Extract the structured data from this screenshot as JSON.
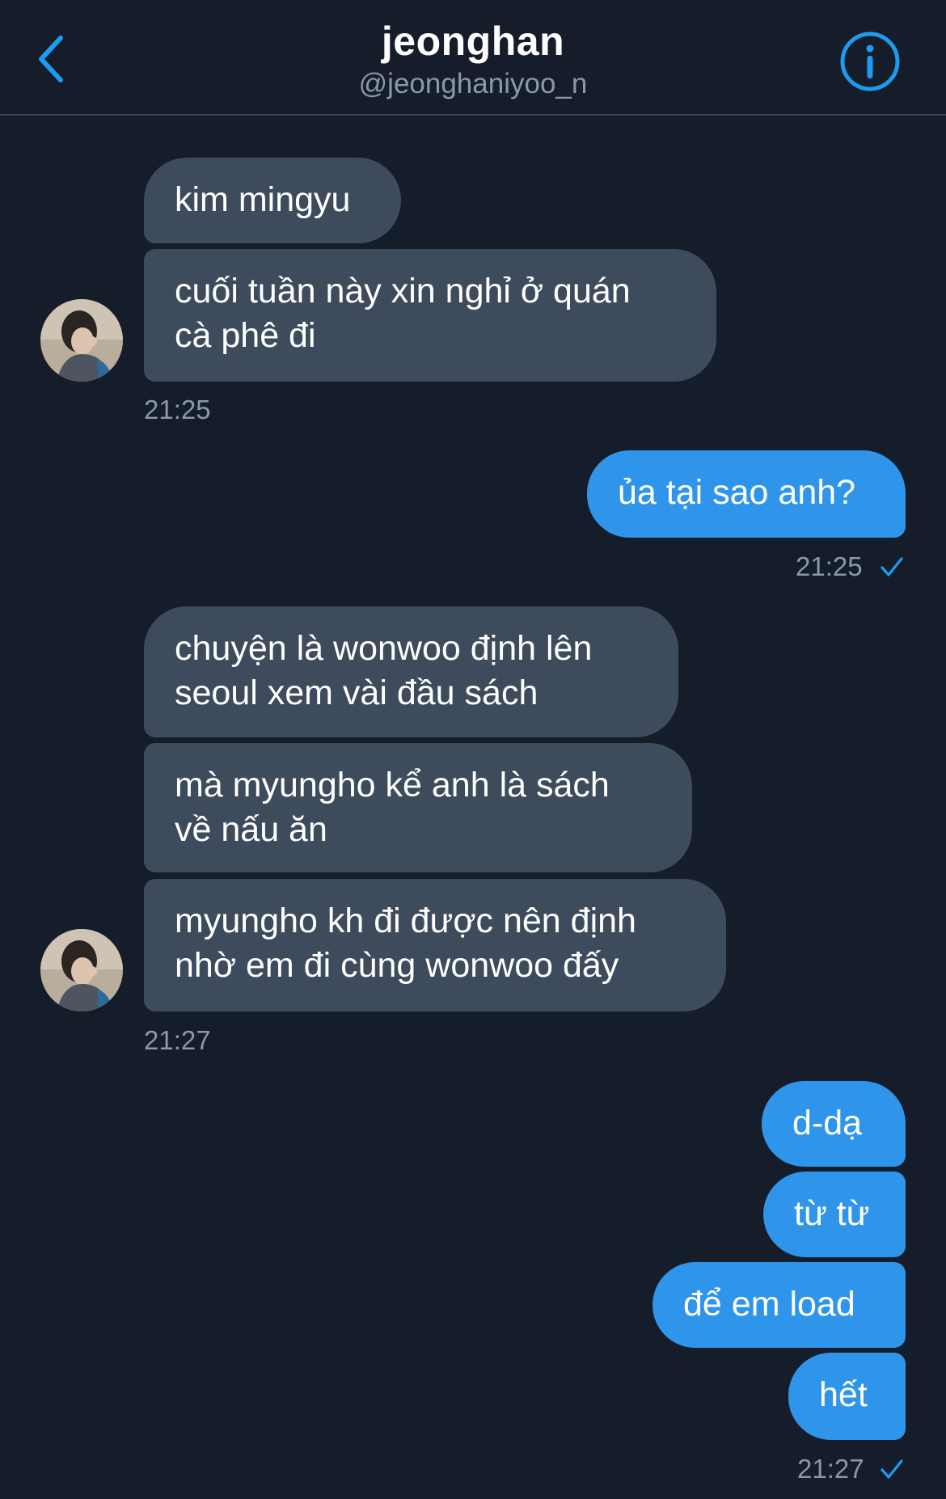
{
  "header": {
    "name": "jeonghan",
    "handle": "@jeonghaniyoo_n"
  },
  "messages": {
    "m1": "kim mingyu",
    "m2_l1": "cuối tuần này xin nghỉ ở quán",
    "m2_l2": "cà phê đi",
    "t1": "21:25",
    "m3": "ủa tại sao anh?",
    "t2": "21:25",
    "m4_l1": "chuyện là wonwoo định lên",
    "m4_l2": "seoul xem vài đầu sách",
    "m5_l1": "mà myungho kể anh là sách",
    "m5_l2": "về nấu ăn",
    "m6_l1": "myungho kh đi được nên định",
    "m6_l2": "nhờ em đi cùng wonwoo đấy",
    "t3": "21:27",
    "m7": "d-dạ",
    "m8": "từ từ",
    "m9": "để em load",
    "m10": "hết",
    "t4": "21:27"
  },
  "colors": {
    "background": "#151d2a",
    "incoming_bubble": "#3d4b5c",
    "outgoing_bubble": "#2f95ea",
    "accent": "#1d9bf0"
  },
  "icons": {
    "back": "chevron-left-icon",
    "info": "info-icon",
    "read": "check-icon"
  }
}
